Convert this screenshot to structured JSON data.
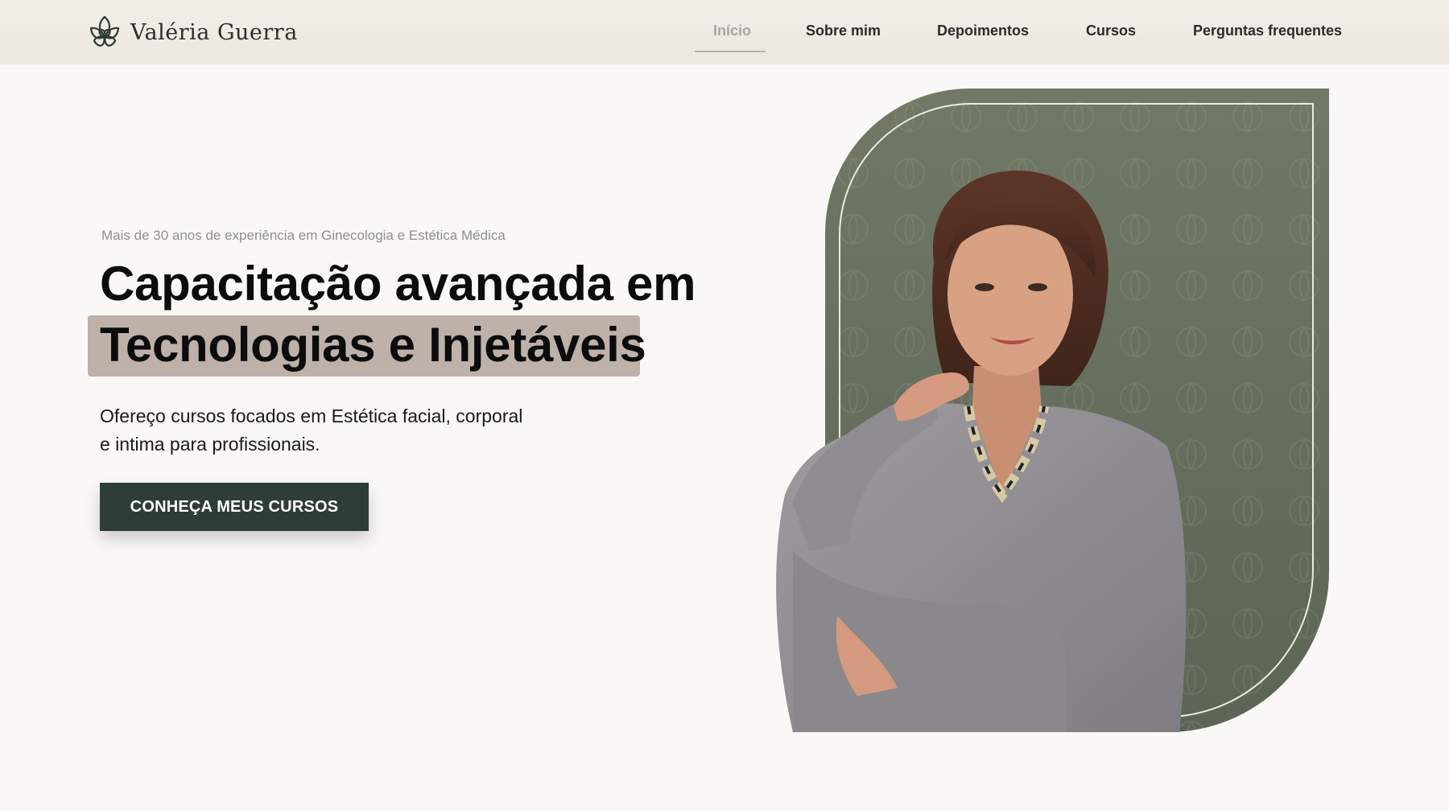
{
  "header": {
    "logo_text": "Valéria Guerra",
    "nav": [
      {
        "label": "Início",
        "active": true
      },
      {
        "label": "Sobre mim",
        "active": false
      },
      {
        "label": "Depoimentos",
        "active": false
      },
      {
        "label": "Cursos",
        "active": false
      },
      {
        "label": "Perguntas frequentes",
        "active": false
      }
    ]
  },
  "hero": {
    "eyebrow": "Mais de 30 anos de experiência em Ginecologia e Estética Médica",
    "headline_line1": "Capacitação avançada em",
    "headline_line2": "Tecnologias e Injetáveis",
    "description_line1": "Ofereço cursos focados em Estética facial, corporal",
    "description_line2": "e intima para profissionais.",
    "cta_label": "CONHEÇA MEUS CURSOS"
  },
  "colors": {
    "header_bg": "#eee9e2",
    "page_bg": "#f9f8f6",
    "highlight": "#beb1a9",
    "cta_bg": "#2e3d37",
    "card_green": "#66705f",
    "nav_active": "#a5a5a5"
  },
  "icons": {
    "logo": "lotus-heart-icon"
  }
}
